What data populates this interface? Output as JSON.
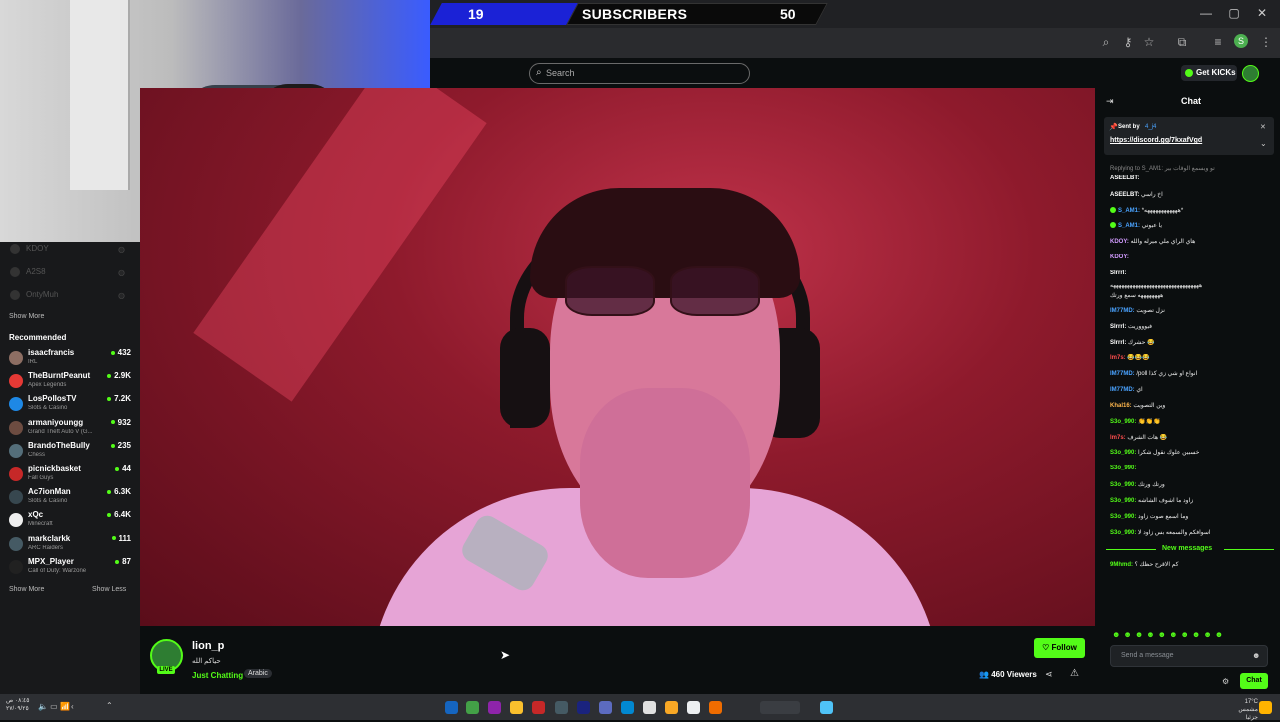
{
  "subscriber_banner": {
    "left_count": "19",
    "label": "SUBSCRIBERS",
    "right_count": "50"
  },
  "header": {
    "search_placeholder": "Search",
    "get_kicks_label": "Get KICKs"
  },
  "sidebar": {
    "following": [
      "KDOY",
      "A2S8",
      "OntyMuh"
    ],
    "show_more_top": "Show More",
    "recommended_title": "Recommended",
    "recommended": [
      {
        "name": "isaacfrancis",
        "category": "IRL",
        "viewers": "432",
        "color": "#8d6e63"
      },
      {
        "name": "TheBurntPeanut",
        "category": "Apex Legends",
        "viewers": "2.9K",
        "color": "#e53935"
      },
      {
        "name": "LosPollosTV",
        "category": "Slots & Casino",
        "viewers": "7.2K",
        "color": "#1e88e5"
      },
      {
        "name": "armaniyoungg",
        "category": "Grand Theft Auto V (G...",
        "viewers": "932",
        "color": "#6d4c41"
      },
      {
        "name": "BrandoTheBully",
        "category": "Chess",
        "viewers": "235",
        "color": "#546e7a"
      },
      {
        "name": "picnickbasket",
        "category": "Fall Guys",
        "viewers": "44",
        "color": "#c62828"
      },
      {
        "name": "Ac7ionMan",
        "category": "Slots & Casino",
        "viewers": "6.3K",
        "color": "#37474f"
      },
      {
        "name": "xQc",
        "category": "Minecraft",
        "viewers": "6.4K",
        "color": "#eeeeee"
      },
      {
        "name": "markclarkk",
        "category": "ARC Raiders",
        "viewers": "111",
        "color": "#455a64"
      },
      {
        "name": "MPX_Player",
        "category": "Call of Duty: Warzone",
        "viewers": "87",
        "color": "#212121"
      }
    ],
    "show_more_bottom": "Show More",
    "show_less": "Show Less"
  },
  "stream": {
    "streamer": "lion_p",
    "title": "حياكم الله",
    "live_badge": "LIVE",
    "category": "Just Chatting",
    "tag": "Arabic",
    "follow_label": "Follow",
    "viewers": "460 Viewers"
  },
  "chat": {
    "title": "Chat",
    "pinned": {
      "sent_by": "Sent by",
      "user": "4_j4",
      "link": "https://discord.gg/7kxafVgd"
    },
    "replying": "Replying to S_AM1: تو ويسمع الوقات بير",
    "messages": [
      {
        "user": "ASEELBT:",
        "text": "",
        "color": "#ffffff",
        "badge": false
      },
      {
        "user": "ASEELBT:",
        "text": "اخ راسي",
        "color": "#ffffff",
        "badge": false
      },
      {
        "user": "S_AM1:",
        "text": "*ههههههههههههه*",
        "color": "#4aa3ff",
        "badge": true
      },
      {
        "user": "S_AM1:",
        "text": "يا عيوني",
        "color": "#4aa3ff",
        "badge": true
      },
      {
        "user": "KDOY:",
        "text": "هاي الراي ملي ميرله والله",
        "color": "#d29bff",
        "badge": false
      },
      {
        "user": "KDOY:",
        "text": "",
        "color": "#d29bff",
        "badge": false
      },
      {
        "user": "Slrrrl:",
        "text": "",
        "color": "#ffffff",
        "badge": false
      },
      {
        "user": "",
        "text": "ههههههههههههههههههههههههههههههههه",
        "color": "#ffffff",
        "badge": false
      },
      {
        "user": "",
        "text": "ههههههههه سمع ورتك",
        "color": "#ffffff",
        "badge": false
      },
      {
        "user": "IM77MD:",
        "text": "نزل تصويت",
        "color": "#4aa3ff",
        "badge": false
      },
      {
        "user": "Slrrrl:",
        "text": "فيوووريت",
        "color": "#ffffff",
        "badge": false
      },
      {
        "user": "Slrrrl:",
        "text": "حشرك 😂",
        "color": "#ffffff",
        "badge": false
      },
      {
        "user": "lm7s:",
        "text": "😂😂😂",
        "color": "#ff4d4d",
        "badge": false
      },
      {
        "user": "IM77MD:",
        "text": "/poll انواع او شي زي كذا",
        "color": "#4aa3ff",
        "badge": false
      },
      {
        "user": "IM77MD:",
        "text": "اي",
        "color": "#4aa3ff",
        "badge": false
      },
      {
        "user": "Khal16:",
        "text": "وين التصويت",
        "color": "#ffb74d",
        "badge": false
      },
      {
        "user": "S3o_990:",
        "text": "👏👏👏",
        "color": "#53fc18",
        "badge": false
      },
      {
        "user": "lm7s:",
        "text": "هات الشرف 😂",
        "color": "#ff4d4d",
        "badge": false
      },
      {
        "user": "S3o_990:",
        "text": "خسبين علوك نقول شكرا",
        "color": "#53fc18",
        "badge": false
      },
      {
        "user": "S3o_990:",
        "text": "",
        "color": "#53fc18",
        "badge": false
      },
      {
        "user": "S3o_990:",
        "text": "ورتك ورتك",
        "color": "#53fc18",
        "badge": false
      },
      {
        "user": "S3o_990:",
        "text": "زاود ما اشوف الشاشه",
        "color": "#53fc18",
        "badge": false
      },
      {
        "user": "S3o_990:",
        "text": "وما اسمع صوت زاود",
        "color": "#53fc18",
        "badge": false
      },
      {
        "user": "S3o_990:",
        "text": "اسوافكم والسمعه بس زاود لا",
        "color": "#53fc18",
        "badge": false
      }
    ],
    "new_messages_label": "New messages",
    "after_new": {
      "user": "9Mhmd:",
      "text": "كم الاقرح حظك ؟",
      "color": "#53fc18"
    },
    "input_placeholder": "Send a message",
    "chat_button": "Chat"
  },
  "taskbar": {
    "time": "٠٨:٤٥ ص",
    "date": "٢٧/٠٩/٢٥",
    "weather": "17°C",
    "weather_desc": "مشمس جزئيا"
  },
  "colors": {
    "accent": "#53fc18",
    "banner_blue": "#1b22d6"
  }
}
